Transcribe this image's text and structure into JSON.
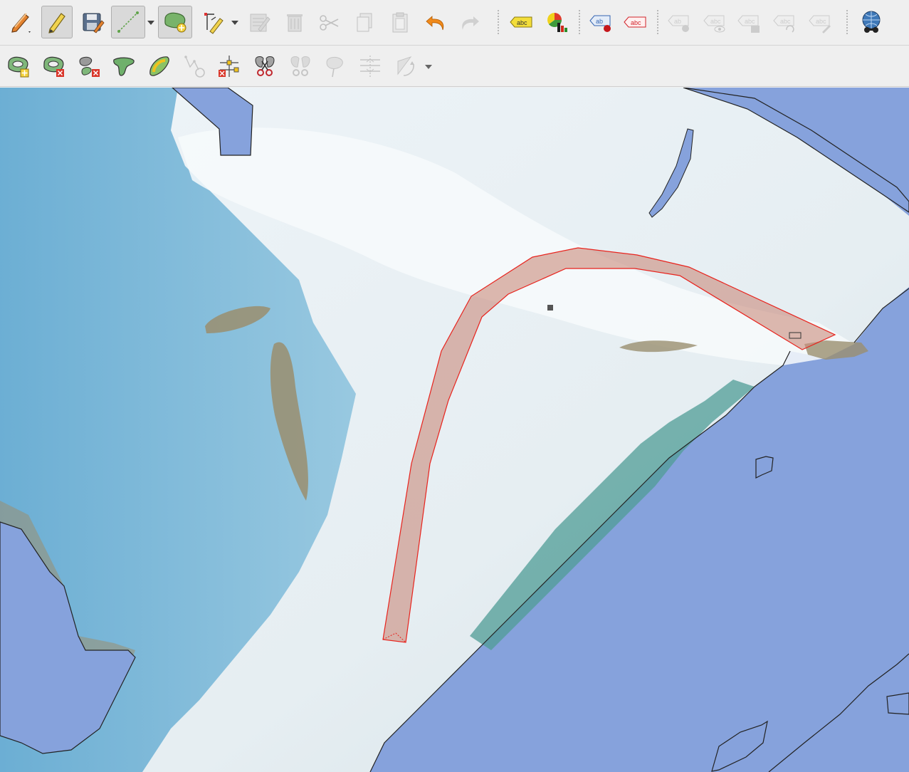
{
  "app": "QGIS map editor",
  "toolbar_digitizing": {
    "items": [
      {
        "id": "current-edits",
        "icon": "pencil-dropdown-icon",
        "enabled": true
      },
      {
        "id": "toggle-editing",
        "icon": "pencil-icon",
        "enabled": true,
        "active": true
      },
      {
        "id": "save-layer-edits",
        "icon": "floppy-pencil-icon",
        "enabled": true
      },
      {
        "id": "digitize-line",
        "icon": "polyline-icon",
        "enabled": true,
        "active": true
      },
      {
        "id": "add-polygon",
        "icon": "add-polygon-icon",
        "enabled": true,
        "active": true
      },
      {
        "id": "vertex-tool",
        "icon": "vertex-tool-icon",
        "enabled": true
      },
      {
        "id": "modify-attributes",
        "icon": "edit-table-icon",
        "enabled": false
      },
      {
        "id": "delete-selected",
        "icon": "trash-icon",
        "enabled": false
      },
      {
        "id": "cut-features",
        "icon": "scissors-icon",
        "enabled": false
      },
      {
        "id": "copy-features",
        "icon": "copy-icon",
        "enabled": false
      },
      {
        "id": "paste-features",
        "icon": "paste-icon",
        "enabled": false
      },
      {
        "id": "undo",
        "icon": "undo-icon",
        "enabled": true
      },
      {
        "id": "redo",
        "icon": "redo-icon",
        "enabled": false
      }
    ]
  },
  "toolbar_labels": {
    "label_text": "abc",
    "pin_label_text": "ab",
    "items": [
      {
        "id": "layer-labeling",
        "icon": "label-abc-icon",
        "enabled": true
      },
      {
        "id": "layer-diagram",
        "icon": "diagram-icon",
        "enabled": true
      },
      {
        "id": "pin-labels",
        "icon": "pin-label-icon",
        "enabled": true
      },
      {
        "id": "highlight-labels",
        "icon": "highlight-label-icon",
        "enabled": true
      },
      {
        "id": "pin-diagram",
        "icon": "pin-diagram-icon",
        "enabled": false
      },
      {
        "id": "show-hide-labels",
        "icon": "show-hide-label-icon",
        "enabled": false
      },
      {
        "id": "move-label",
        "icon": "move-label-icon",
        "enabled": false
      },
      {
        "id": "rotate-label",
        "icon": "rotate-label-icon",
        "enabled": false
      },
      {
        "id": "change-label",
        "icon": "change-label-icon",
        "enabled": false
      },
      {
        "id": "globe",
        "icon": "globe-binoculars-icon",
        "enabled": true
      }
    ]
  },
  "toolbar_advanced": {
    "items": [
      {
        "id": "add-ring",
        "icon": "add-ring-icon",
        "enabled": true
      },
      {
        "id": "delete-ring",
        "icon": "delete-ring-icon",
        "enabled": true
      },
      {
        "id": "delete-part",
        "icon": "delete-part-icon",
        "enabled": true
      },
      {
        "id": "reshape-features",
        "icon": "reshape-icon",
        "enabled": true
      },
      {
        "id": "offset-curve",
        "icon": "offset-curve-icon",
        "enabled": true
      },
      {
        "id": "simplify",
        "icon": "simplify-icon",
        "enabled": false
      },
      {
        "id": "split-parts",
        "icon": "split-parts-icon",
        "enabled": true
      },
      {
        "id": "split-features",
        "icon": "split-features-icon",
        "enabled": true
      },
      {
        "id": "merge-selected",
        "icon": "merge-icon",
        "enabled": false
      },
      {
        "id": "merge-attributes",
        "icon": "merge-attributes-icon",
        "enabled": false
      },
      {
        "id": "align-points",
        "icon": "align-points-icon",
        "enabled": false
      },
      {
        "id": "rotate-feature",
        "icon": "rotate-feature-icon",
        "enabled": false
      }
    ]
  },
  "map": {
    "colors": {
      "sea": "#86a2dc",
      "land_pale": "#d9e6ec",
      "land_snow": "#f2f6f8",
      "land_blue": "#6fb0d6",
      "land_teal": "#4e9c9a",
      "rock": "#9a8e6f",
      "buffer_fill": "#c98a7c",
      "buffer_stroke": "#e8231d"
    }
  }
}
